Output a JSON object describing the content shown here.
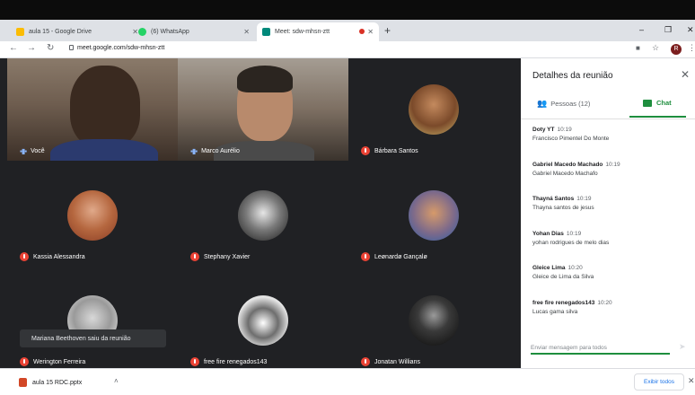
{
  "browser": {
    "tabs": [
      {
        "label": "aula 15 - Google Drive",
        "favicon_color": "#fbbc04"
      },
      {
        "label": "(6) WhatsApp",
        "favicon_color": "#25d366"
      },
      {
        "label": "Meet: sdw-mhsn-ztt",
        "favicon_color": "#00897b",
        "active": true
      }
    ],
    "new_tab": "+",
    "window_controls": [
      "–",
      "❐",
      "✕"
    ],
    "url": "meet.google.com/sdw-mhsn-ztt",
    "profile_initial": "R"
  },
  "participants": [
    {
      "name": "Você",
      "audio": "speaking"
    },
    {
      "name": "Marco Aurélio",
      "audio": "speaking"
    },
    {
      "name": "Bárbara Santos",
      "audio": "muted"
    },
    {
      "name": "Kassia Alessandra",
      "audio": "muted"
    },
    {
      "name": "Stephany Xavier",
      "audio": "muted"
    },
    {
      "name": "Leønardø Gançalø",
      "audio": "muted"
    },
    {
      "name": "Werington Ferreira",
      "audio": "muted"
    },
    {
      "name": "free fire renegados143",
      "audio": "muted"
    },
    {
      "name": "Jonatan Willians",
      "audio": "muted"
    }
  ],
  "toast": "Mariana Beethoven saiu da reunião",
  "panel": {
    "title": "Detalhes da reunião",
    "people_tab": "Pessoas (12)",
    "chat_tab": "Chat",
    "messages": [
      {
        "sender": "Doty YT",
        "time": "10:19",
        "text": "Francisco Pimentel Do Monte"
      },
      {
        "sender": "Gabriel Macedo Machado",
        "time": "10:19",
        "text": "Gabriel Macedo Machafo"
      },
      {
        "sender": "Thayná Santos",
        "time": "10:19",
        "text": "Thayna santos de jesus"
      },
      {
        "sender": "Yohan Dias",
        "time": "10:19",
        "text": "yohan rodrigues de melo dias"
      },
      {
        "sender": "Gleice Lima",
        "time": "10:20",
        "text": "Gleice de Lima da Silva"
      },
      {
        "sender": "free fire renegados143",
        "time": "10:20",
        "text": "Lucas gama silva"
      }
    ],
    "input_placeholder": "Enviar mensagem para todos"
  },
  "downloads": {
    "file": "aula 15 RDC.pptx",
    "show_all": "Exibir todos"
  },
  "colors": {
    "accent": "#1e8e3e",
    "muted": "#ea4335"
  }
}
